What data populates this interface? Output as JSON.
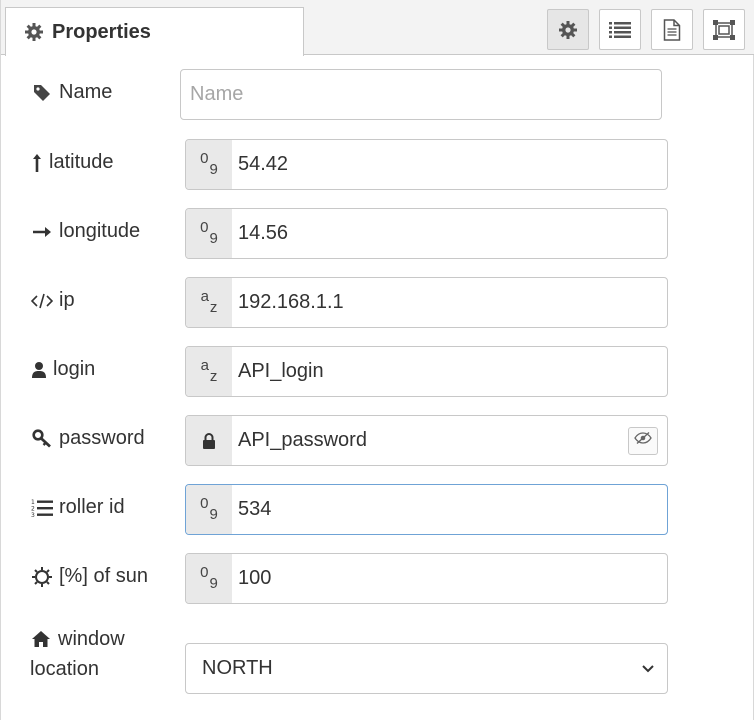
{
  "header": {
    "tab_title": "Properties",
    "buttons": [
      {
        "icon": "gear-icon",
        "active": true
      },
      {
        "icon": "list-icon",
        "active": false
      },
      {
        "icon": "document-icon",
        "active": false
      },
      {
        "icon": "frame-icon",
        "active": false
      }
    ]
  },
  "form": {
    "name": {
      "label": "Name",
      "placeholder": "Name",
      "value": ""
    },
    "latitude": {
      "label": "latitude",
      "type_badge": "0-9",
      "value": "54.42"
    },
    "longitude": {
      "label": "longitude",
      "type_badge": "0-9",
      "value": "14.56"
    },
    "ip": {
      "label": "ip",
      "type_badge": "a-z",
      "value": "192.168.1.1"
    },
    "login": {
      "label": "login",
      "type_badge": "a-z",
      "value": "API_login"
    },
    "password": {
      "label": "password",
      "value": "API_password"
    },
    "roller_id": {
      "label": "roller id",
      "type_badge": "0-9",
      "value": "534"
    },
    "sun": {
      "label": "[%] of sun",
      "type_badge": "0-9",
      "value": "100"
    },
    "window_location": {
      "label_line1": "window",
      "label_line2": "location",
      "selected": "NORTH"
    }
  }
}
